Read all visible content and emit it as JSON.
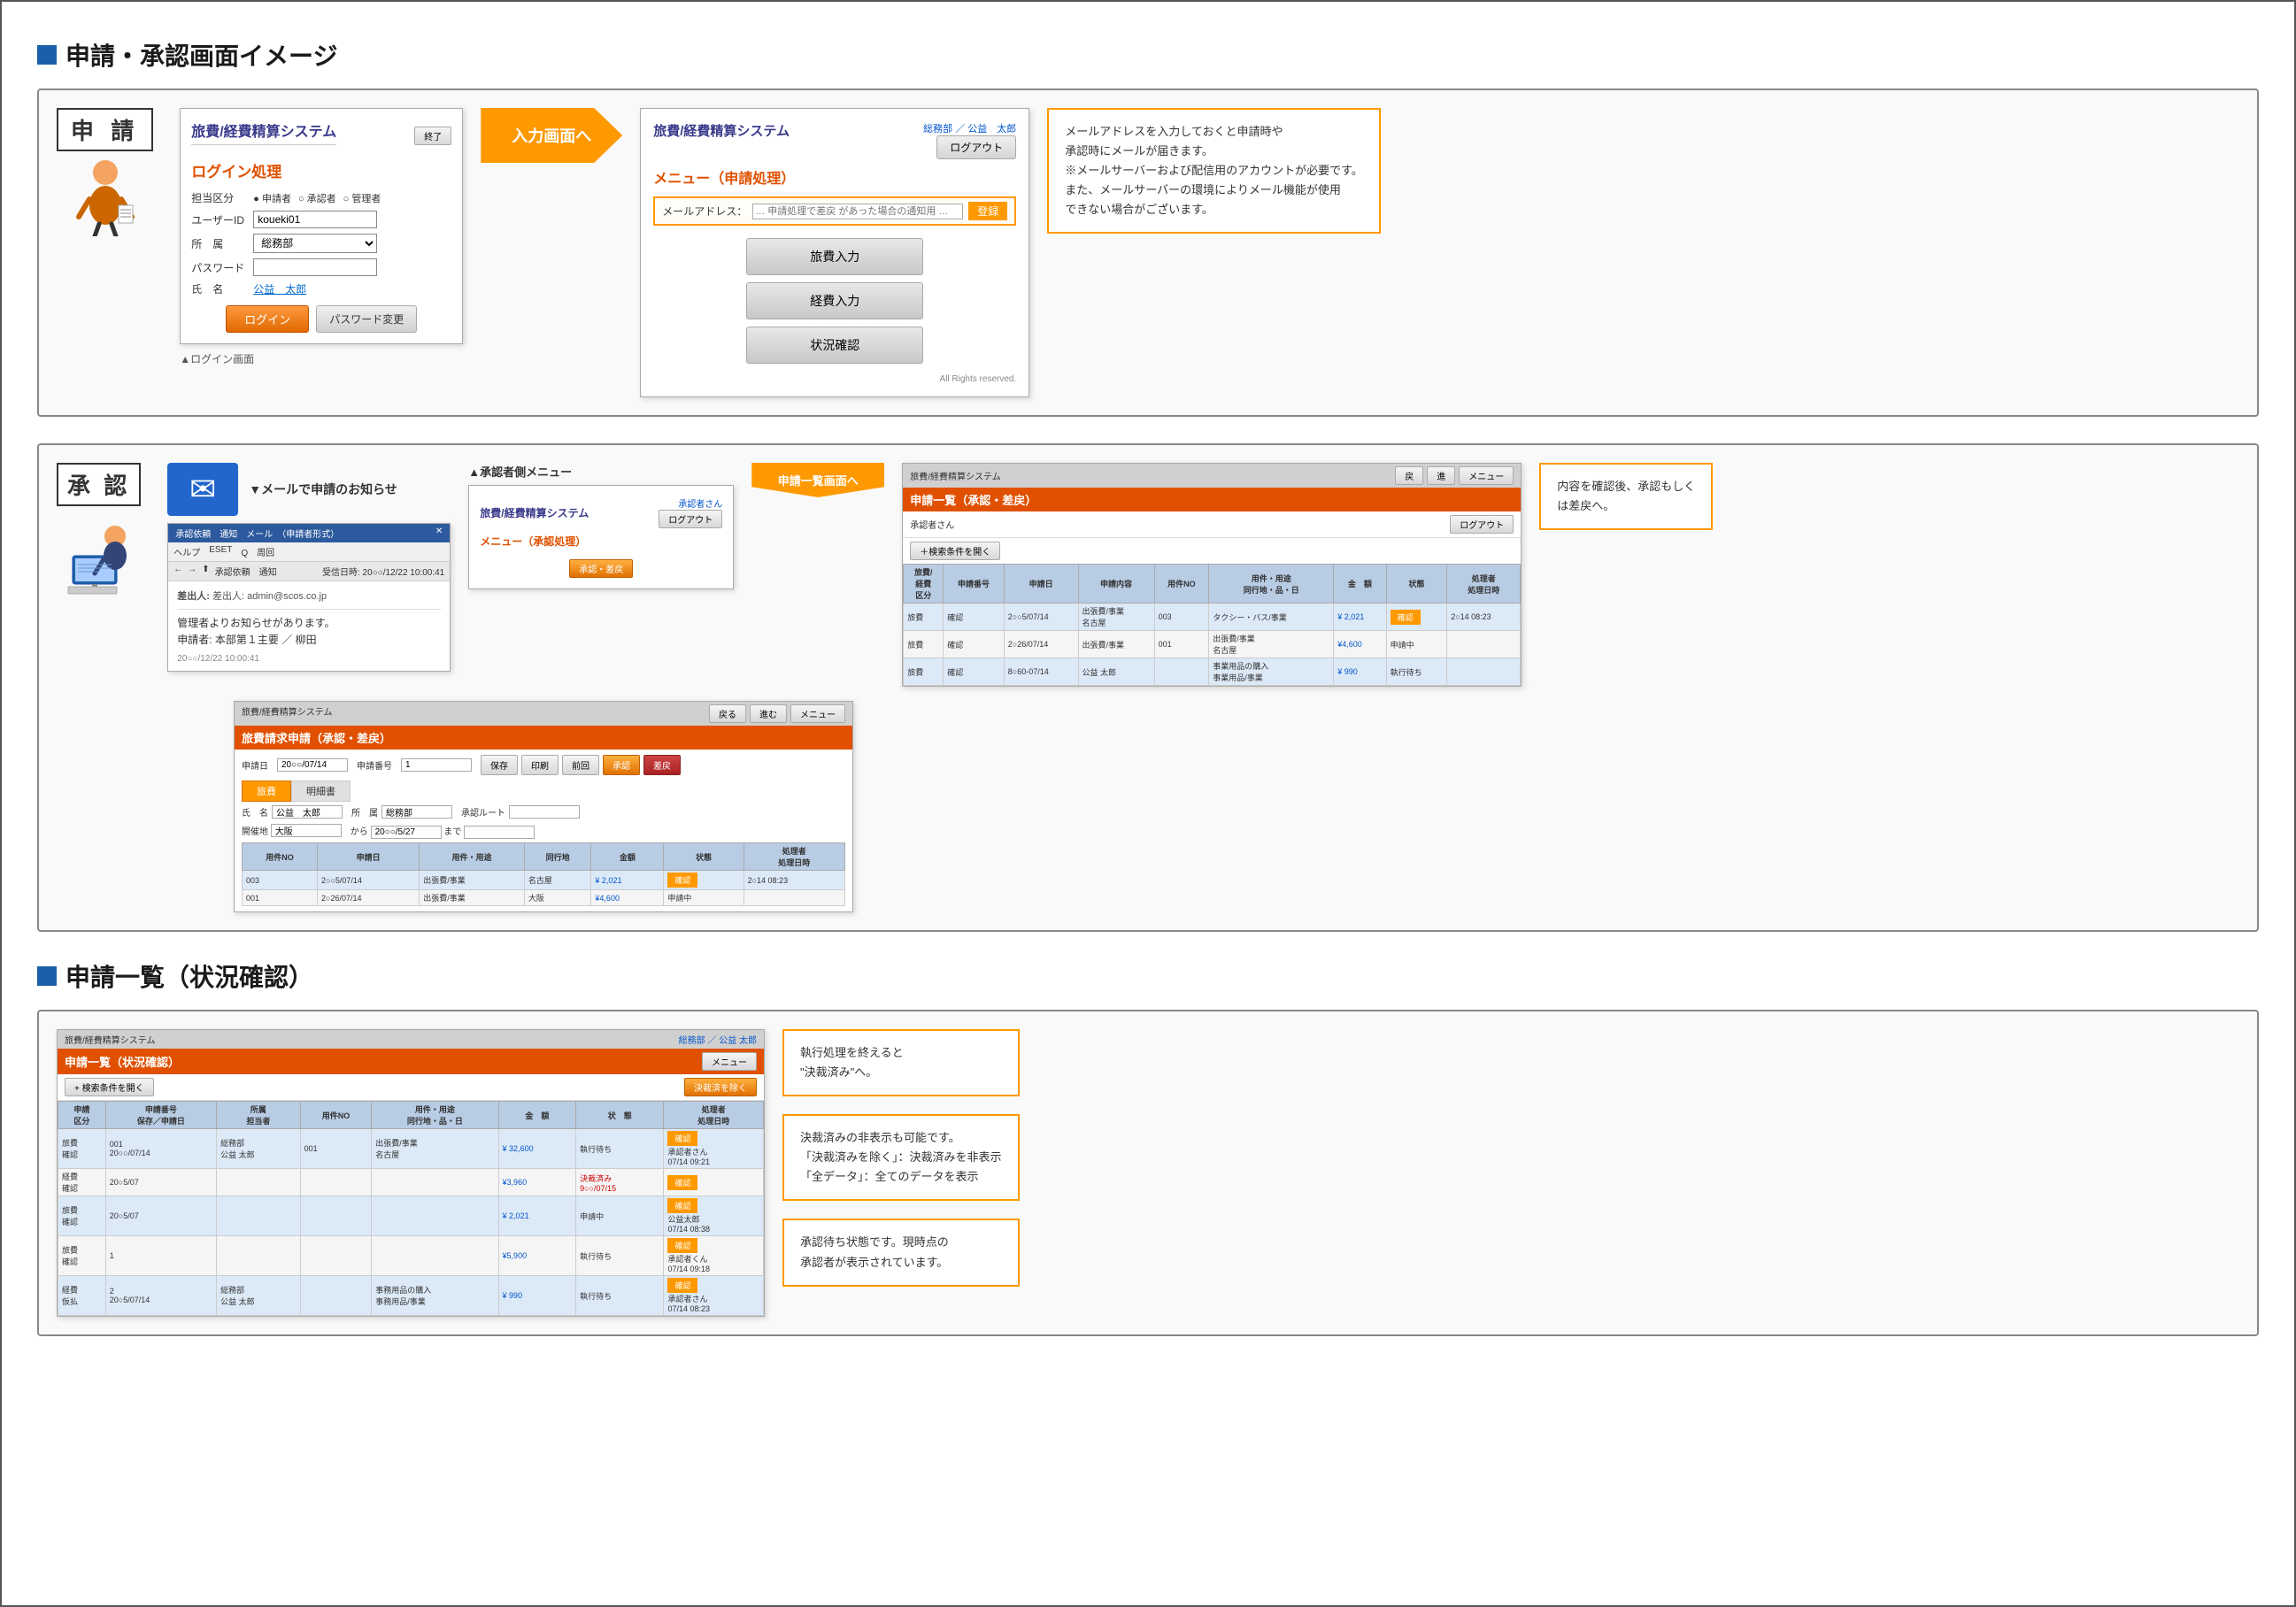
{
  "page": {
    "border_color": "#555",
    "background": "#fff"
  },
  "section1": {
    "header": "申請・承認画面イメージ",
    "apply_label": "申 請",
    "login_caption": "▲ログイン画面",
    "login_screen": {
      "title": "旅費/経費精算システム",
      "end_btn": "終了",
      "subtitle": "ログイン処理",
      "row1_label": "担当区分",
      "radio1": "申請者",
      "radio2": "承認者",
      "radio3": "管理者",
      "row2_label": "ユーザーID",
      "userid_value": "koueki01",
      "row3_label": "所　属",
      "dept_value": "総務部",
      "row4_label": "パスワード",
      "row5_label": "氏　名",
      "name_value": "公益　太郎",
      "btn_login": "ログイン",
      "btn_password": "パスワード変更"
    },
    "menu_screen": {
      "title": "旅費/経費精算システム",
      "subtitle": "メニュー（申請処理）",
      "dept": "総務部",
      "slash": "／",
      "user": "公益　太郎",
      "logout_btn": "ログアウト",
      "email_label": "メールアドレス：",
      "email_placeholder": "… 申請処理で差戻 があった場合の通知用 …",
      "email_register_btn": "登録",
      "btn1": "旅費入力",
      "btn2": "経費入力",
      "btn3": "状況確認",
      "footer": "All Rights reserved.",
      "arrow_label": "入力画面へ"
    },
    "callout1": {
      "text": "メールアドレスを入力しておくと申請時や\n承認時にメールが届きます。\n※メールサーバーおよび配信用のアカウントが必要です。\nまた、メールサーバーの環境によりメール機能が使用\nできない場合がございます。"
    }
  },
  "section2": {
    "approval_label": "承 認",
    "mail_notify_label": "▼メールで申請のお知らせ",
    "approval_menu_label": "▲承認者側メニュー",
    "email_mock": {
      "titlebar": "承認依頼　通知　メール　（申請者形式）",
      "from": "差出人: admin@scos.co.jp",
      "subject": "承認依頼　通知",
      "body_line1": "管理者よりお知らせがあります。",
      "body_line2": "申請者: 本部第１主要 ／ 柳田",
      "timestamp": "20○○/12/22 10:00:41"
    },
    "approval_menu_screen": {
      "title": "旅費/経費精算システム",
      "subtitle": "メニュー（承認処理）",
      "user": "承認者さん",
      "logout_btn": "ログアウト",
      "btn_shinsei": "承認・差戻"
    },
    "request_list_screen": {
      "title": "旅費/経費精算システム",
      "subtitle": "申請一覧（承認・差戻）",
      "approval_user": "承認者さん",
      "search_btn": "＋検索条件を開く",
      "cols": [
        "旅費/\n経費\n区分",
        "申請\n番号",
        "申請日",
        "申請内容",
        "用件NO",
        "用件・用途\n同行地・品・日",
        "金　額",
        "状態",
        "処理者\n処理日時"
      ],
      "rows": [
        [
          "旅費",
          "確認",
          "2○○5/07/14",
          "出張費/事業\n名古屋",
          "003",
          "タクシー・バス/事\n業",
          "¥ 2,021",
          "確認",
          "2○14 08:23"
        ],
        [
          "旅費",
          "確認",
          "2○26/07/14",
          "出張費/事業",
          "001",
          "出張費/事業\n名古屋",
          "¥4,600",
          "申請中",
          ""
        ],
        [
          "旅費",
          "確認",
          "8○60-07/14",
          "公益 太郎",
          "",
          "事業用品の購入\n事業用品/事業",
          "¥ 990",
          "執行待ち",
          ""
        ]
      ],
      "arrow_label": "申請一覧画面へ"
    },
    "callout2": {
      "text": "内容を確認後、承認もしく\nは差戻へ。"
    }
  },
  "section3": {
    "header": "申請一覧（状況確認）",
    "status_list": {
      "title": "旅費/経費精算システム",
      "subtitle": "申請一覧（状況確認）",
      "dept": "総務部",
      "slash": "／",
      "user": "公益 太郎",
      "menu_btn": "メニュー",
      "search_btn": "+ 検索条件を開く",
      "exclude_btn": "決裁済を除く",
      "cols": [
        "申請\n区分",
        "申請番号\n保存／申請日",
        "所属\n担当者",
        "用件NO",
        "用件・用途\n同行地・品・日",
        "金　額",
        "状　態",
        "処理者者\n処理日時"
      ],
      "rows": [
        [
          "旅費\n確認",
          "001\n20○○/07/14",
          "総務部\n公益 太郎",
          "001",
          "出張費/事業\n名古屋",
          "¥ 32,600",
          "執行待ち",
          "承認者さん\n07/14 09:21"
        ],
        [
          "経費\n確認",
          "20○5/07",
          "",
          "",
          "",
          "¥3,960",
          "決裁済み\n9○○/07/15",
          "確認",
          ""
        ],
        [
          "旅費\n確認",
          "20○5/07",
          "",
          "",
          "",
          "¥ 2,021",
          "申請中",
          "確認",
          "公益太郎\n07/14 08:38"
        ],
        [
          "旅費\n確認",
          "1",
          "",
          "",
          "",
          "¥5,900",
          "執行待ち",
          "確認",
          "承認者くん\n07/14 09:18"
        ],
        [
          "経費\n仮払",
          "2\n20○5/07/14",
          "総務部\n公益 太郎",
          "",
          "事務用品の購入\n事務用品/事業",
          "¥ 990",
          "執行待ち",
          "承認者さん\n07/14 08:23"
        ]
      ]
    },
    "callout3": {
      "text": "執行処理を終えると\n\"決裁済み\"へ。"
    },
    "callout4": {
      "text": "決裁済みの非表示も可能です。\n「決裁済みを除く」：決裁済みを非表示\n「全データ」：全てのデータを表示"
    },
    "callout5": {
      "text": "承認待ち状態です。現時点の\n承認者が表示されています。"
    }
  },
  "icons": {
    "mail": "✉",
    "radio_checked": "●",
    "radio_unchecked": "○",
    "arrow_right": "▶",
    "arrow_down": "▼"
  }
}
